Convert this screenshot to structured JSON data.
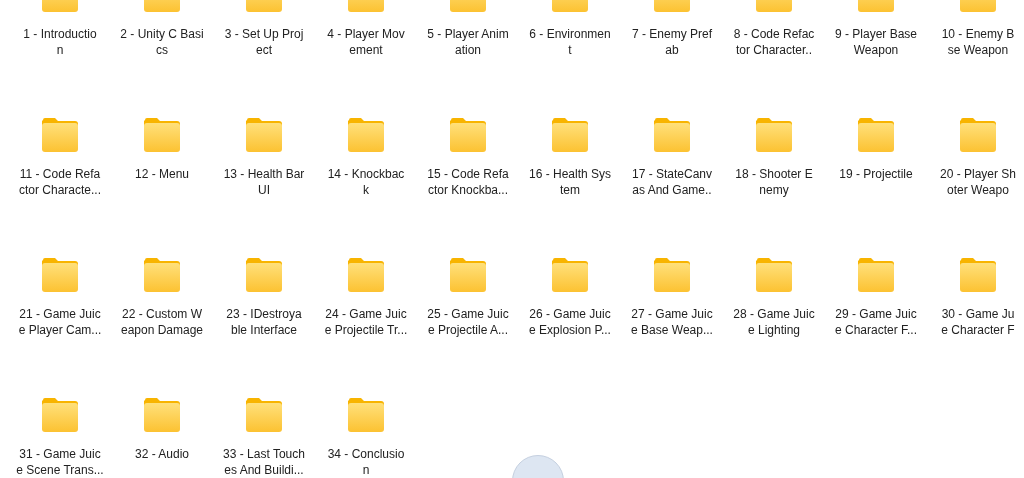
{
  "folders": [
    {
      "lines": [
        "1 - Introductio",
        "n"
      ]
    },
    {
      "lines": [
        "2 - Unity C Basi",
        "cs"
      ]
    },
    {
      "lines": [
        "3 - Set Up Proj",
        "ect"
      ]
    },
    {
      "lines": [
        "4 - Player Mov",
        "ement"
      ]
    },
    {
      "lines": [
        "5 - Player Anim",
        "ation"
      ]
    },
    {
      "lines": [
        "6 - Environmen",
        "t"
      ]
    },
    {
      "lines": [
        "7 - Enemy Pref",
        "ab"
      ]
    },
    {
      "lines": [
        "8 - Code Refac",
        "tor Character.."
      ]
    },
    {
      "lines": [
        "9 - Player Base",
        "Weapon"
      ]
    },
    {
      "lines": [
        "10 - Enemy B",
        "se Weapon"
      ]
    },
    {
      "lines": [
        "11 - Code Refa",
        "ctor Characte..."
      ]
    },
    {
      "lines": [
        "12 - Menu"
      ]
    },
    {
      "lines": [
        "13 - Health Bar",
        "UI"
      ]
    },
    {
      "lines": [
        "14 - Knockbac",
        "k"
      ]
    },
    {
      "lines": [
        "15 - Code Refa",
        "ctor Knockba..."
      ]
    },
    {
      "lines": [
        "16 - Health Sys",
        "tem"
      ]
    },
    {
      "lines": [
        "17 - StateCanv",
        "as And Game.."
      ]
    },
    {
      "lines": [
        "18 - Shooter E",
        "nemy"
      ]
    },
    {
      "lines": [
        "19 - Projectile"
      ]
    },
    {
      "lines": [
        "20 - Player Sh",
        "oter Weapo"
      ]
    },
    {
      "lines": [
        "21 - Game Juic",
        "e Player Cam..."
      ]
    },
    {
      "lines": [
        "22 - Custom W",
        "eapon Damage"
      ]
    },
    {
      "lines": [
        "23 - IDestroya",
        "ble Interface"
      ]
    },
    {
      "lines": [
        "24 - Game Juic",
        "e Projectile Tr..."
      ]
    },
    {
      "lines": [
        "25 - Game Juic",
        "e Projectile A..."
      ]
    },
    {
      "lines": [
        "26 - Game Juic",
        "e Explosion P..."
      ]
    },
    {
      "lines": [
        "27 - Game Juic",
        "e Base Weap..."
      ]
    },
    {
      "lines": [
        "28 - Game Juic",
        "e Lighting"
      ]
    },
    {
      "lines": [
        "29 - Game Juic",
        "e Character F..."
      ]
    },
    {
      "lines": [
        "30 - Game Ju",
        "e Character F"
      ]
    },
    {
      "lines": [
        "31 - Game Juic",
        "e Scene Trans..."
      ]
    },
    {
      "lines": [
        "32 - Audio"
      ]
    },
    {
      "lines": [
        "33 - Last Touch",
        "es And Buildi..."
      ]
    },
    {
      "lines": [
        "34 - Conclusio",
        "n"
      ]
    }
  ]
}
